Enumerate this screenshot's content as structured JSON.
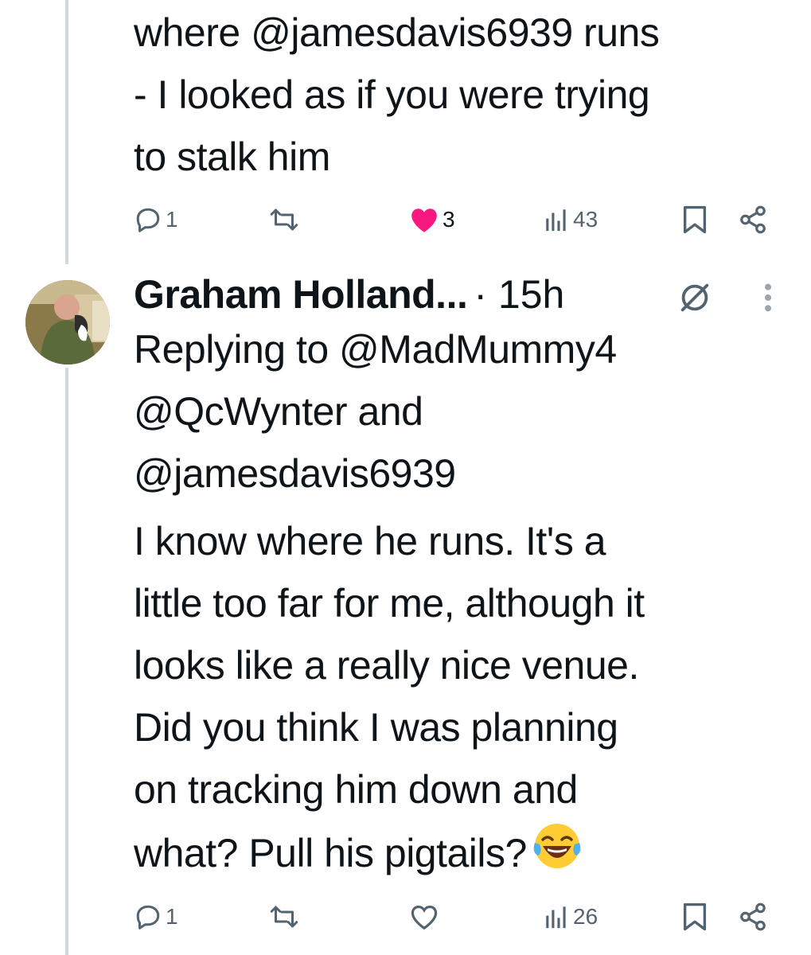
{
  "tweet1": {
    "text_lines": [
      "where @jamesdavis6939 runs",
      "- I looked as if you were trying",
      "to stalk him"
    ],
    "actions": {
      "reply_count": "1",
      "like_count": "3",
      "views_count": "43"
    },
    "liked": true
  },
  "tweet2": {
    "author_name": "Graham Holland...",
    "time": "· 15h",
    "replying_lines": [
      "Replying to @MadMummy4",
      "@QcWynter and",
      "@jamesdavis6939"
    ],
    "text_lines": [
      "I know where he runs. It's a",
      "little too far for me, although it",
      "looks like a really nice venue.",
      "Did you think I was planning",
      "on tracking him down and",
      "what? Pull his pigtails?"
    ],
    "emoji": "face-with-tears-of-joy",
    "actions": {
      "reply_count": "1",
      "like_count": "",
      "views_count": "26"
    },
    "liked": false
  },
  "colors": {
    "text": "#0f1419",
    "muted": "#536471",
    "like_active": "#f91880",
    "thread_line": "#cfd9de"
  },
  "icons": {
    "reply": "reply-icon",
    "retweet": "retweet-icon",
    "like": "heart-icon",
    "views": "views-bar-icon",
    "bookmark": "bookmark-icon",
    "share": "share-icon",
    "grok": "grok-icon",
    "more": "more-vertical-icon"
  }
}
